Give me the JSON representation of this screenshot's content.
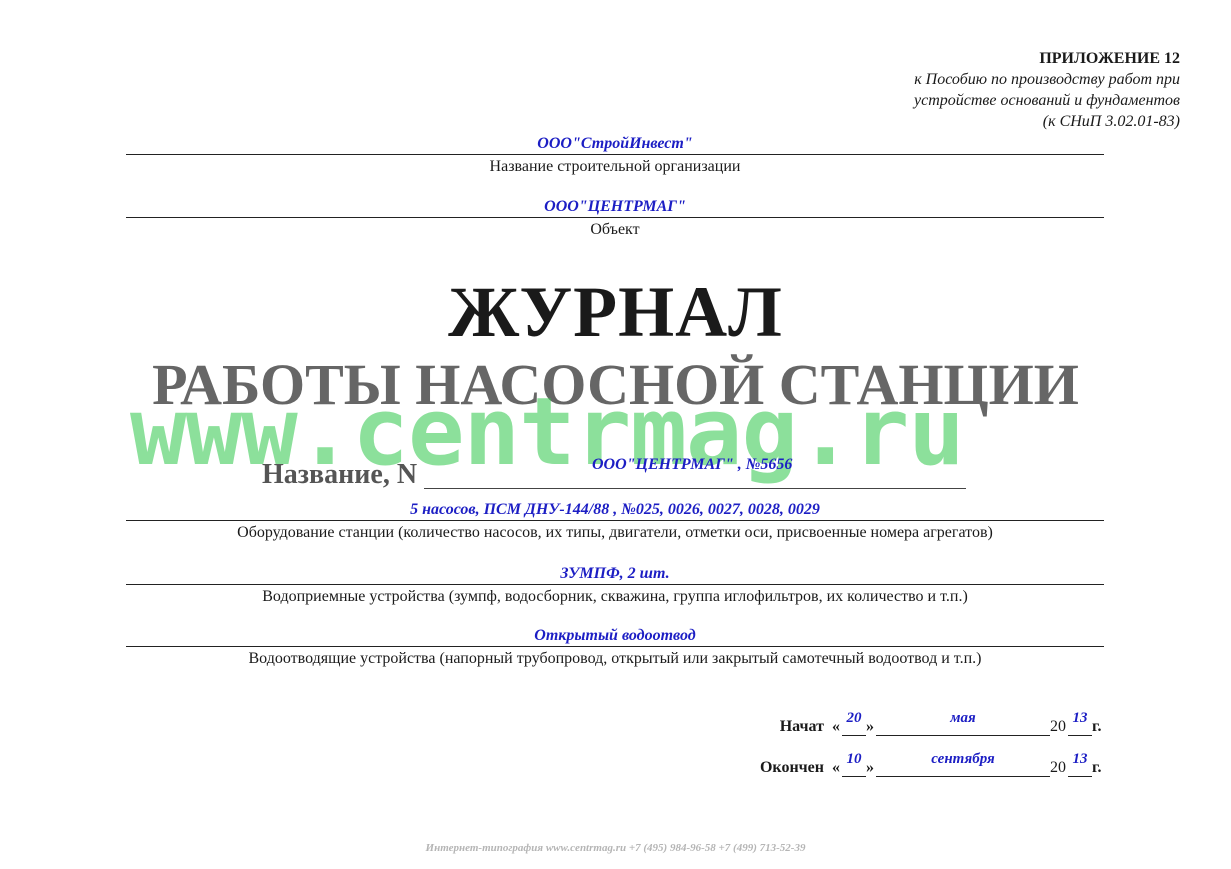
{
  "appendix": {
    "title": "ПРИЛОЖЕНИЕ 12",
    "lines": [
      "к Пособию по производству работ при",
      "устройстве оснований и фундаментов",
      "(к СНиП 3.02.01-83)"
    ]
  },
  "organization": {
    "value": "ООО\"СтройИнвест\"",
    "caption": "Название строительной организации"
  },
  "object": {
    "value": "ООО\"ЦЕНТРМАГ\"",
    "caption": "Объект"
  },
  "title": {
    "main": "ЖУРНАЛ",
    "sub": "РАБОТЫ НАСОСНОЙ СТАНЦИИ"
  },
  "watermark": "www.centrmag.ru",
  "name": {
    "label": "Название, N",
    "value": "ООО\"ЦЕНТРМАГ\" , №5656"
  },
  "equipment": {
    "value": "5 насосов, ПСМ ДНУ-144/88 , №025, 0026, 0027, 0028, 0029",
    "caption": "Оборудование станции (количество насосов, их типы, двигатели, отметки оси, присвоенные номера агрегатов)"
  },
  "intake": {
    "value": "ЗУМПФ, 2 шт.",
    "caption": "Водоприемные устройства (зумпф, водосборник, скважина, группа иглофильтров, их количество и т.п.)"
  },
  "drainage": {
    "value": "Открытый водоотвод",
    "caption": "Водоотводящие устройства (напорный трубопровод, открытый или закрытый самотечный водоотвод и т.п.)"
  },
  "dates": {
    "start": {
      "label": "Начат",
      "day": "20",
      "month": "мая",
      "century": "20",
      "year": "13",
      "suffix": "г."
    },
    "end": {
      "label": "Окончен",
      "day": "10",
      "month": "сентября",
      "century": "20",
      "year": "13",
      "suffix": "г."
    },
    "open_quote": "«",
    "close_quote": "»"
  },
  "footer": "Интернет-типография  www.centrmag.ru   +7 (495) 984-96-58  +7 (499) 713-52-39"
}
